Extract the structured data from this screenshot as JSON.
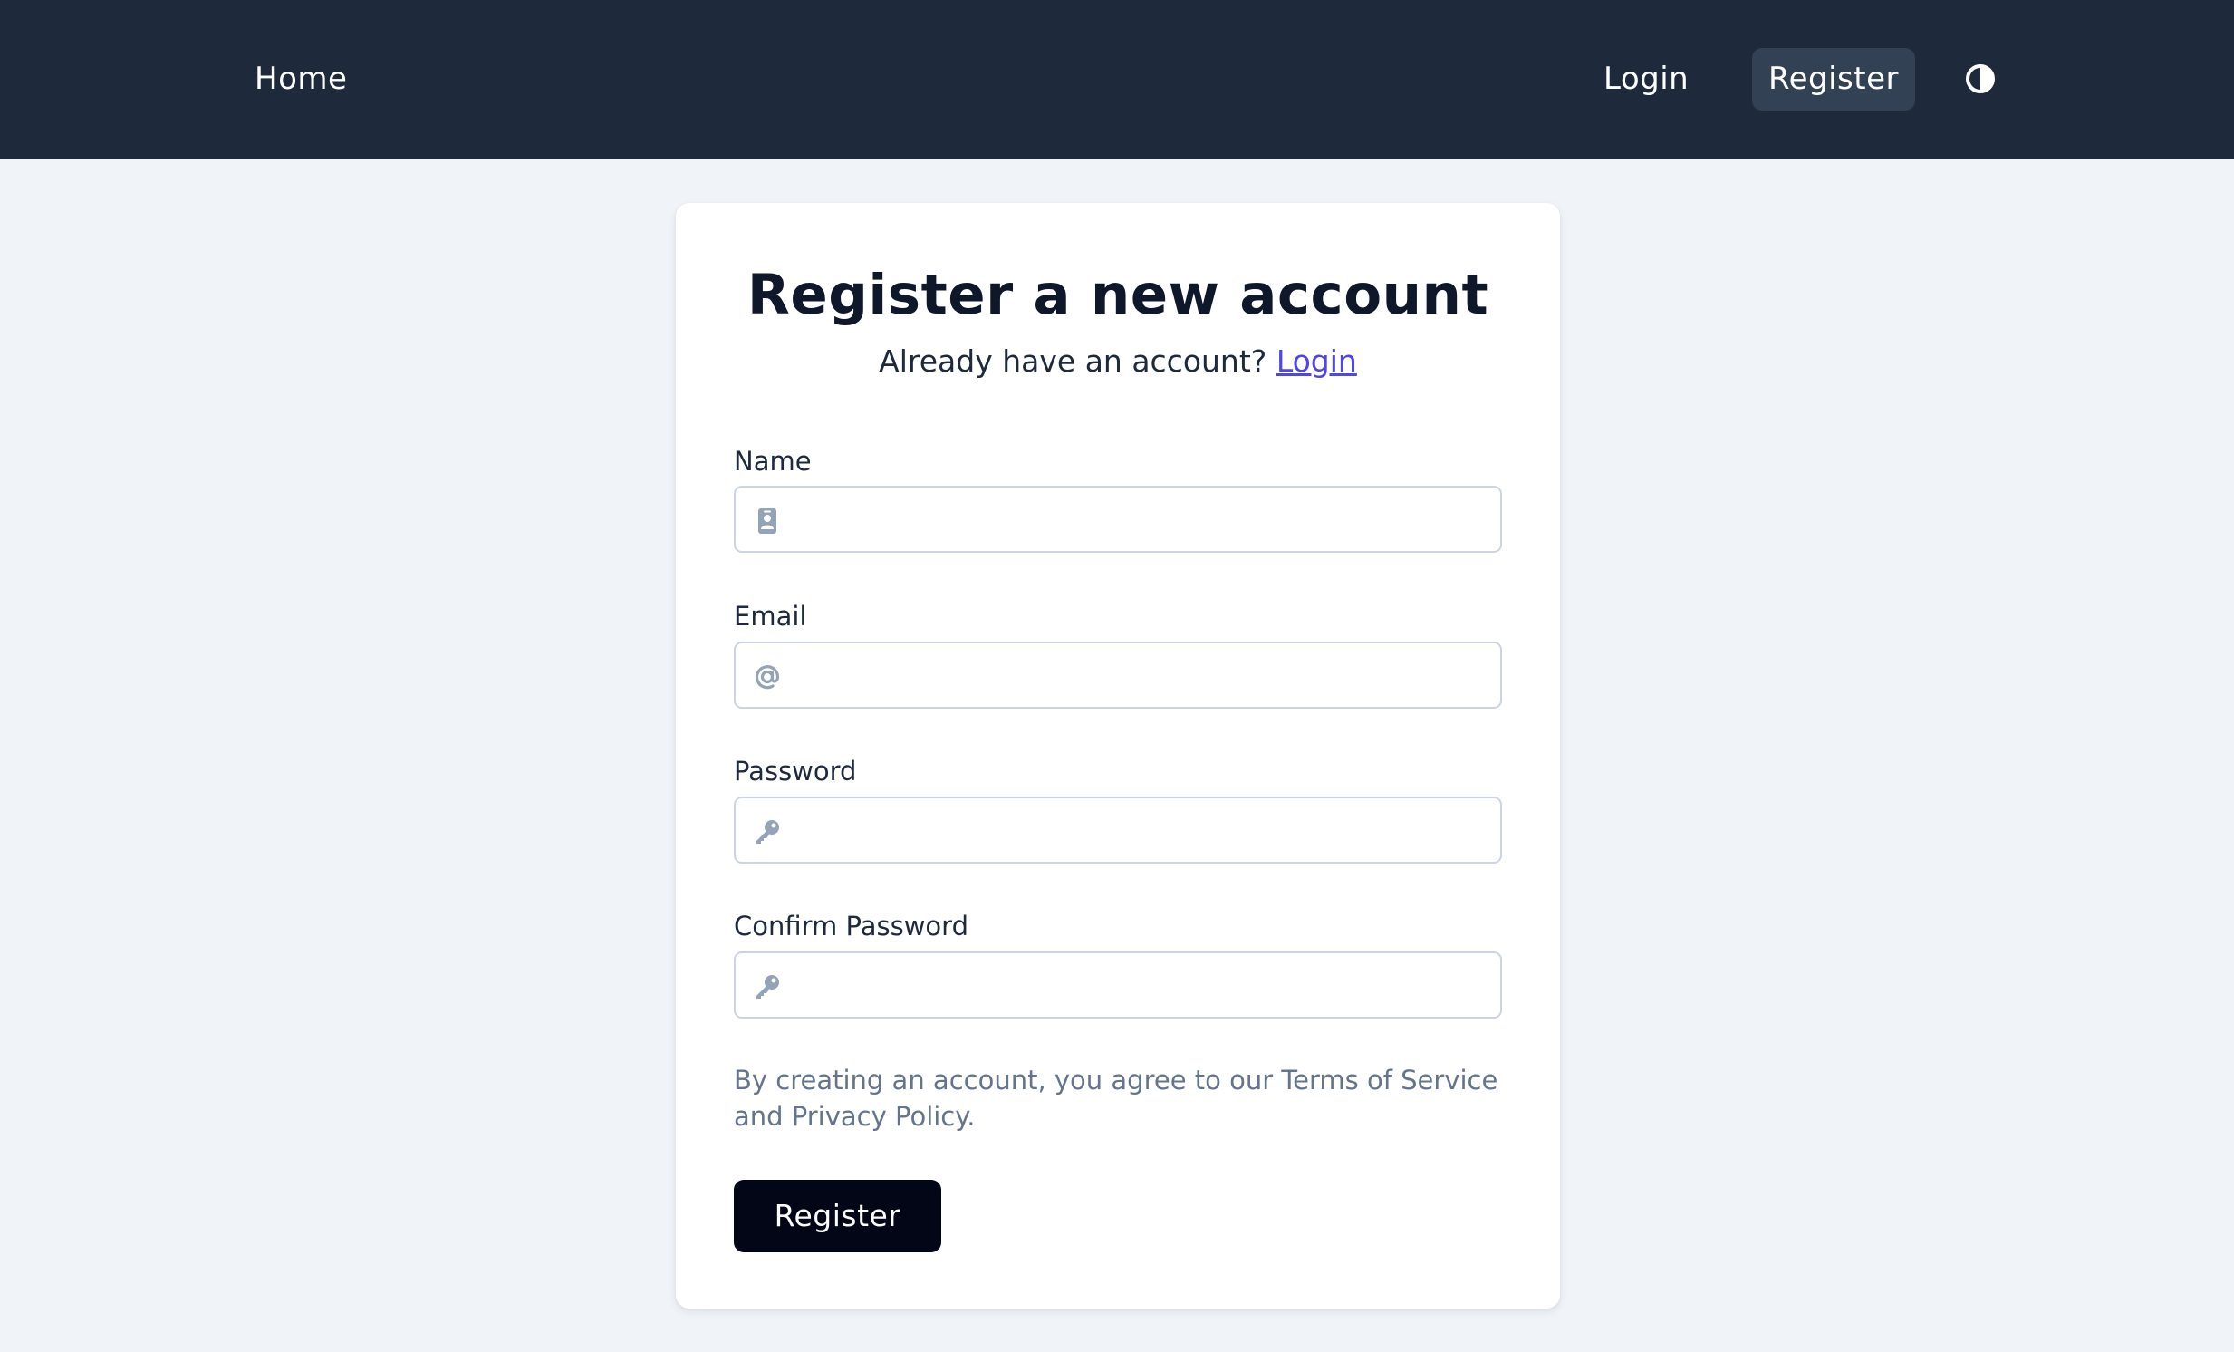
{
  "nav": {
    "home": "Home",
    "login": "Login",
    "register": "Register"
  },
  "form": {
    "title": "Register a new account",
    "subtitle_prefix": "Already have an account?",
    "subtitle_link": "Login",
    "fields": [
      {
        "label": "Name",
        "value": "",
        "icon": "id-badge-icon"
      },
      {
        "label": "Email",
        "value": "",
        "icon": "at-icon"
      },
      {
        "label": "Password",
        "value": "",
        "icon": "key-icon"
      },
      {
        "label": "Confirm Password",
        "value": "",
        "icon": "key-icon"
      }
    ],
    "terms": "By creating an account, you agree to our Terms of Service and Privacy Policy.",
    "submit": "Register"
  },
  "colors": {
    "navbar": "#1e293b",
    "page_bg": "#f0f4f8",
    "link": "#4f46e5",
    "button": "#020617",
    "icon": "#94a3b8"
  }
}
